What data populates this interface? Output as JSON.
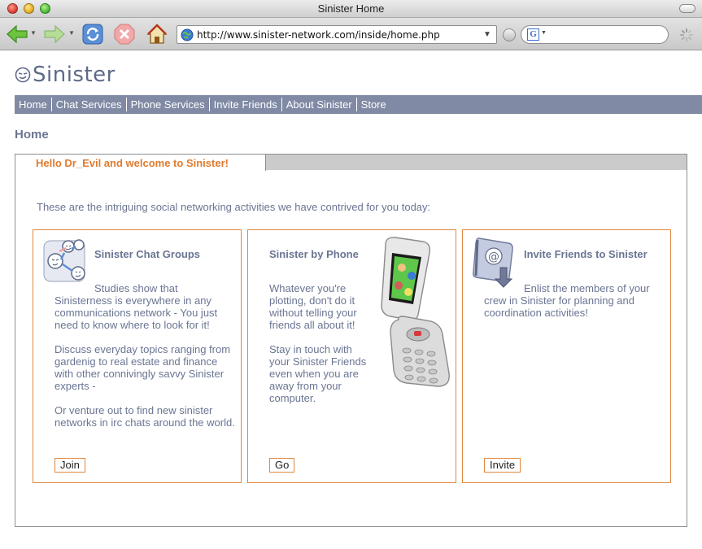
{
  "window": {
    "title": "Sinister Home"
  },
  "toolbar": {
    "url": "http://www.sinister-network.com/inside/home.php",
    "search_placeholder": ""
  },
  "site": {
    "logo_text": "Sinister",
    "nav": [
      "Home",
      "Chat Services",
      "Phone Services",
      "Invite Friends",
      "About Sinister",
      "Store"
    ],
    "page_title": "Home",
    "welcome": "Hello Dr_Evil and welcome to Sinister!",
    "intro": "These are the intriguing social networking activities we have contrived for you today:"
  },
  "cards": [
    {
      "title": "Sinister Chat Groups",
      "lead": "Studies show that",
      "rest": "Sinisterness is everywhere in any communications network - You just need to know where to look for it!",
      "p2": "Discuss everyday topics ranging from gardenig to real estate and finance with other connivingly savvy Sinister experts -",
      "p3": "Or venture out to find new sinister networks in irc chats around the world.",
      "button": "Join",
      "icon": "chat-group-icon"
    },
    {
      "title": "Sinister by Phone",
      "p1": "Whatever you're plotting, don't do it without telling your friends all about it!",
      "p2": "Stay in touch with your Sinister Friends even when you are away from your computer.",
      "button": "Go",
      "icon": "flip-phone-image"
    },
    {
      "title": "Invite Friends to Sinister",
      "lead": "Enlist the members of your",
      "rest": "crew in Sinister for planning and coordination activities!",
      "button": "Invite",
      "icon": "address-book-icon"
    }
  ],
  "colors": {
    "nav_bg": "#808aa5",
    "accent_orange": "#e07a2e",
    "text_slate": "#6a7593"
  }
}
